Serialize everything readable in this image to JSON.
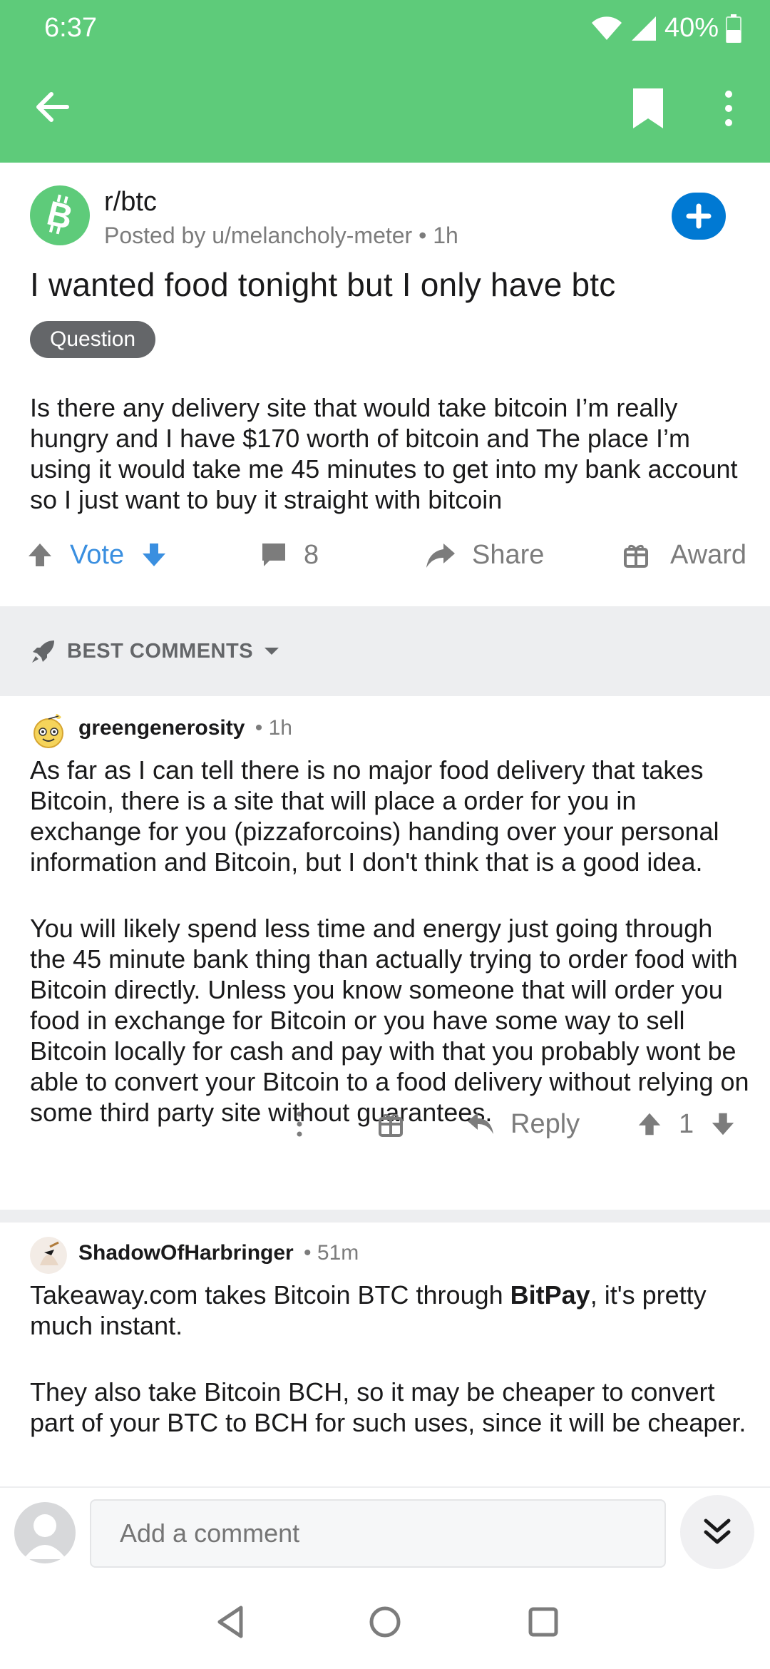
{
  "status_bar": {
    "time": "6:37",
    "battery": "40%"
  },
  "theme": {
    "appbar": "#5ecb7a",
    "accent_blue": "#0079d3",
    "vote_blue": "#3a8fe0",
    "muted": "#7c7c7c",
    "flair_bg": "#646669"
  },
  "toolbar": {
    "back_icon": "arrow-left-icon",
    "bookmark_icon": "bookmark-icon",
    "more_icon": "more-vertical-icon"
  },
  "post": {
    "subreddit": "r/btc",
    "meta": "Posted by u/melancholy-meter • 1h",
    "title": "I wanted food tonight but I only have btc",
    "flair": "Question",
    "body": "Is there any delivery site that would take bitcoin I’m really hungry and I have $170 worth of bitcoin and The place I’m using it would take me 45 minutes to get into my bank account so I just want to buy it straight with bitcoin",
    "vote_label": "Vote",
    "comment_count": "8",
    "share_label": "Share",
    "award_label": "Award"
  },
  "sort": {
    "label": "BEST COMMENTS"
  },
  "comments": [
    {
      "user": "greengenerosity",
      "age": "• 1h",
      "paragraphs": [
        "As far as I can tell there is no major food delivery that takes Bitcoin, there is a site that will place a order for you in exchange for you (pizzaforcoins) handing over your personal information and Bitcoin, but I don't think that is a good idea.",
        "You will likely spend less time and energy just going through the 45 minute bank thing than actually trying to order food with Bitcoin directly. Unless you know someone that will order you food in exchange for Bitcoin or you have some way to sell Bitcoin locally for cash and pay with that you probably wont be able to convert your Bitcoin to a food delivery without relying on some third party site without guarantees."
      ],
      "reply_label": "Reply",
      "score": "1"
    },
    {
      "user": "ShadowOfHarbringer",
      "age": "• 51m",
      "p1_before": "Takeaway.com takes Bitcoin BTC through ",
      "p1_bold": "BitPay",
      "p1_after": ", it's pretty much instant.",
      "p2": "They also take Bitcoin BCH, so it may be cheaper to convert part of your BTC to BCH for such uses, since it will be cheaper."
    }
  ],
  "composer": {
    "placeholder": "Add a comment"
  }
}
